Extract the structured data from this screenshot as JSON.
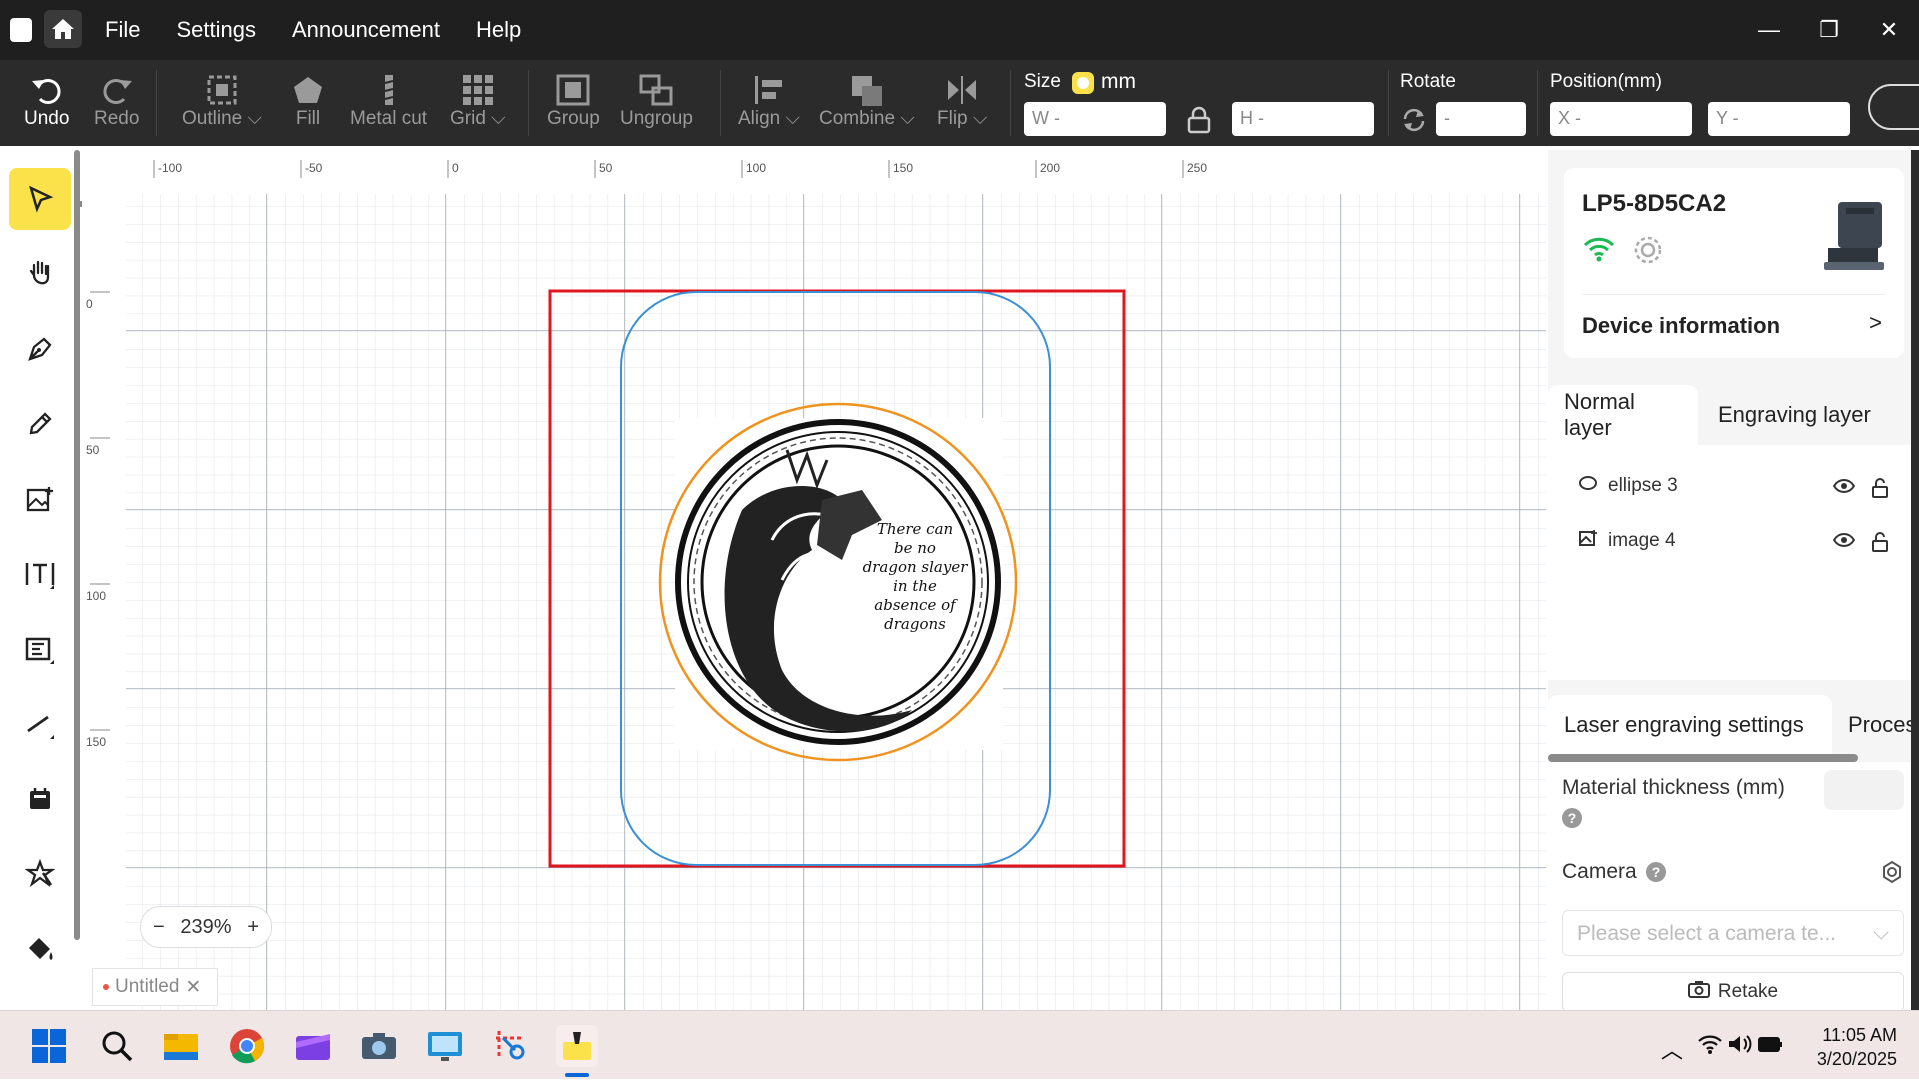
{
  "menu": {
    "items": [
      "File",
      "Settings",
      "Announcement",
      "Help"
    ]
  },
  "toolbar": {
    "undo": "Undo",
    "redo": "Redo",
    "outline": "Outline",
    "fill": "Fill",
    "metal_cut": "Metal cut",
    "grid": "Grid",
    "group": "Group",
    "ungroup": "Ungroup",
    "align": "Align",
    "combine": "Combine",
    "flip": "Flip",
    "size_label": "Size",
    "unit": "mm",
    "w": "W -",
    "h": "H -",
    "rotate_label": "Rotate",
    "rotate_value": "-",
    "position_label": "Position(mm)",
    "x": "X -",
    "y": "Y -"
  },
  "canvas": {
    "ruler_x": [
      "-100",
      "-50",
      "0",
      "50",
      "100",
      "150",
      "200",
      "250"
    ],
    "ruler_y": [
      "0",
      "50",
      "100",
      "150"
    ],
    "quote_lines": [
      "There can",
      "be no",
      "dragon slayer",
      "in the",
      "absence of",
      "dragons"
    ],
    "zoom": "239%",
    "doc_tab": "Untitled"
  },
  "device": {
    "name": "LP5-8D5CA2",
    "info_label": "Device information"
  },
  "layers": {
    "tabs": [
      "Normal layer",
      "Engraving layer"
    ],
    "items": [
      {
        "name": "ellipse 3",
        "icon": "ellipse-icon"
      },
      {
        "name": "image 4",
        "icon": "image-icon"
      }
    ]
  },
  "settings": {
    "tabs": [
      "Laser engraving settings",
      "Proces"
    ],
    "material_thickness": "Material thickness (mm)",
    "camera": "Camera",
    "camera_placeholder": "Please select a camera te...",
    "retake": "Retake"
  },
  "clock": {
    "time": "11:05 AM",
    "date": "3/20/2025"
  },
  "colors": {
    "accent": "#fbe14a",
    "selection": "#e0161e",
    "ellipse": "#f0921e",
    "outline": "#3a8fd6",
    "wifi": "#1db954"
  }
}
